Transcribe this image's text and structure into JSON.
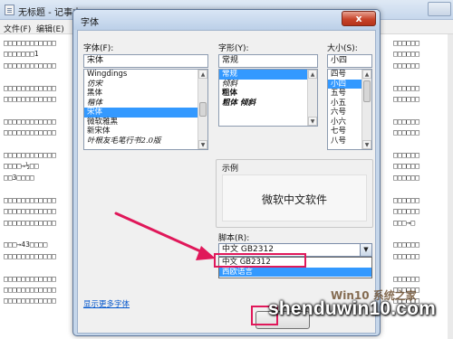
{
  "notepad": {
    "title": "无标题 - 记事本",
    "menu": [
      "文件(F)",
      "编辑(E)"
    ],
    "text_left": [
      "□□□□□□□□□□□□",
      "□□□□□□□1",
      "□□□□□□□□□□□□",
      "",
      "□□□□□□□□□□□□",
      "□□□□□□□□□□□□",
      "",
      "□□□□□□□□□□□□",
      "□□□□□□□□□□□□",
      "",
      "□□□□□□□□□□□□",
      "□□□□→½□□",
      "□□3□□□□",
      "",
      "□□□□□□□□□□□□",
      "□□□□□□□□□□□□",
      "□□□□□□□□□□□□",
      "",
      "□□□→43□□□□",
      "□□□□□□□□□□□□",
      "",
      "□□□□□□□□□□□□",
      "□□□□□□□□□□□□",
      "□□□□□□□□□□□□"
    ],
    "text_right": [
      "□□□□□□",
      "□□□□□□",
      "□□□□□□",
      "",
      "□□□□□□",
      "□□□□□□",
      "",
      "□□□□□□",
      "□□□□□□",
      "",
      "□□□□□□",
      "□□□□□□",
      "□□□□□□",
      "",
      "□□□□□□",
      "□□□□□□",
      "□□□→□",
      "",
      "□□□□□□",
      "□□□□□□",
      "",
      "□□□□□□",
      "□□□□□□",
      "□□□□□□"
    ]
  },
  "dialog": {
    "title": "字体",
    "close_label": "x",
    "font_label": "字体(F):",
    "font_value": "宋体",
    "font_list": [
      "Wingdings",
      "仿宋",
      "黑体",
      "楷体",
      "宋体",
      "微软雅黑",
      "新宋体",
      "叶根友毛笔行书2.0版"
    ],
    "font_selected_index": 4,
    "style_label": "字形(Y):",
    "style_value": "常规",
    "style_list": [
      "常规",
      "倾斜",
      "粗体",
      "粗体 倾斜"
    ],
    "style_selected_index": 0,
    "size_label": "大小(S):",
    "size_value": "小四",
    "size_list": [
      "四号",
      "小四",
      "五号",
      "小五",
      "六号",
      "小六",
      "七号",
      "八号"
    ],
    "size_selected_index": 1,
    "sample_label": "示例",
    "sample_text": "微软中文软件",
    "script_label": "脚本(R):",
    "script_value": "中文 GB2312",
    "script_options": [
      "中文 GB2312",
      "西欧语言"
    ],
    "script_highlight_index": 1,
    "more_fonts_link": "显示更多字体"
  },
  "annotation": {
    "color": "#e0185a"
  },
  "watermark": {
    "text": "shenduwin10.com",
    "logo_text": "Win10 系统之家"
  }
}
